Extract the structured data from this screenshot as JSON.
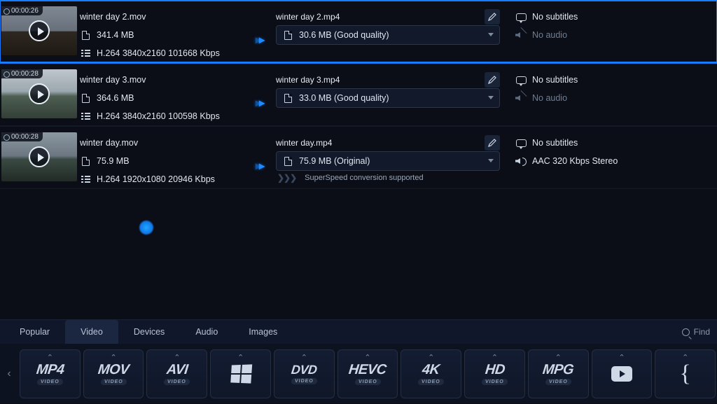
{
  "rows": [
    {
      "selected": true,
      "duration": "00:00:26",
      "src_name": "winter day 2.mov",
      "src_size": "341.4 MB",
      "src_codec": "H.264 3840x2160 101668 Kbps",
      "dst_name": "winter day 2.mp4",
      "dst_size": "30.6 MB (Good quality)",
      "note": "",
      "subs": "No subtitles",
      "audio": "No audio",
      "audio_muted": true,
      "scene": "scene1"
    },
    {
      "selected": false,
      "duration": "00:00:28",
      "src_name": "winter day 3.mov",
      "src_size": "364.6 MB",
      "src_codec": "H.264 3840x2160 100598 Kbps",
      "dst_name": "winter day 3.mp4",
      "dst_size": "33.0 MB (Good quality)",
      "note": "",
      "subs": "No subtitles",
      "audio": "No audio",
      "audio_muted": true,
      "scene": "scene2"
    },
    {
      "selected": false,
      "duration": "00:00:28",
      "src_name": "winter day.mov",
      "src_size": "75.9 MB",
      "src_codec": "H.264 1920x1080 20946 Kbps",
      "dst_name": "winter day.mp4",
      "dst_size": "75.9 MB (Original)",
      "note": "SuperSpeed conversion supported",
      "subs": "No subtitles",
      "audio": "AAC 320 Kbps Stereo",
      "audio_muted": false,
      "scene": "scene3"
    }
  ],
  "tabs": {
    "items": [
      "Popular",
      "Video",
      "Devices",
      "Audio",
      "Images"
    ],
    "active": 1
  },
  "find_label": "Find",
  "formats": [
    "MP4",
    "MOV",
    "AVI",
    "WIN",
    "DVD",
    "HEVC",
    "4K",
    "HD",
    "MPG",
    "YT",
    "CURLY"
  ]
}
